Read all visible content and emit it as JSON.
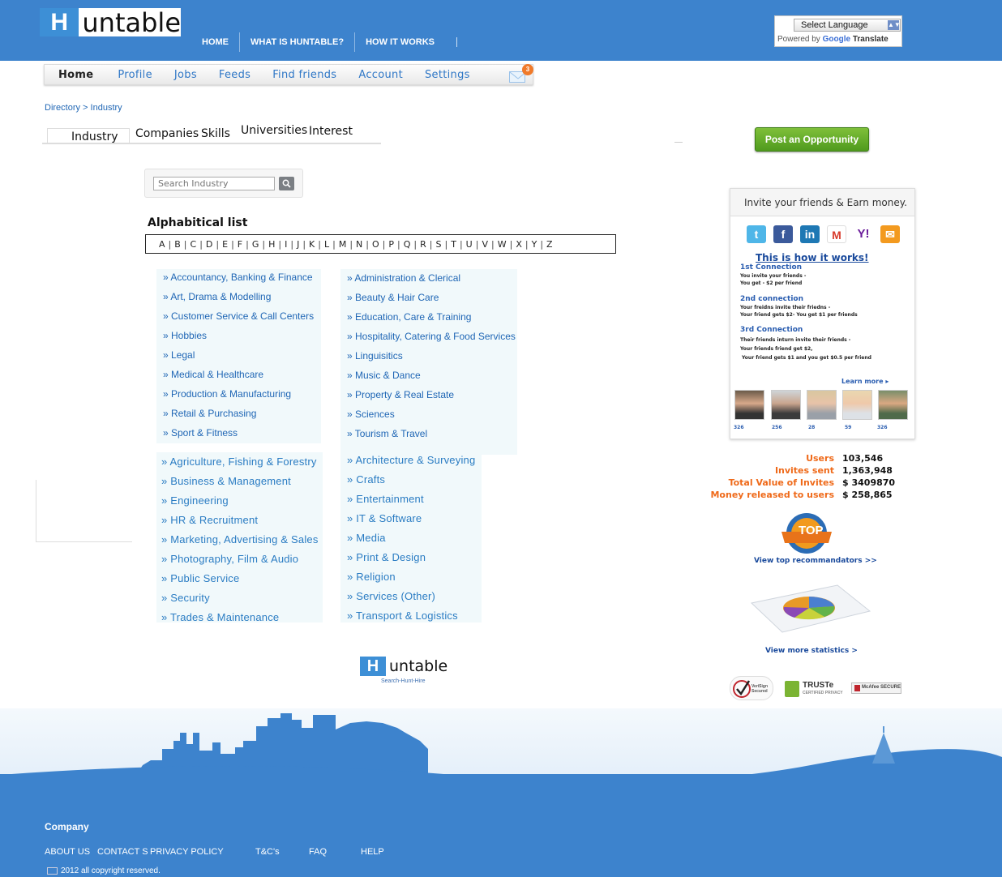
{
  "header": {
    "logo_letter": "H",
    "logo_rest": "untable",
    "nav": [
      "HOME",
      "WHAT IS HUNTABLE?",
      "HOW IT WORKS"
    ],
    "language_select": "Select Language",
    "powered_by": "Powered by",
    "google": "Google",
    "translate": "Translate"
  },
  "subnav": [
    "Home",
    "Profile",
    "Jobs",
    "Feeds",
    "Find friends",
    "Account",
    "Settings"
  ],
  "mail_count": "3",
  "breadcrumb": "Directory > Industry",
  "tabs": [
    "Industry",
    "Companies",
    "Skills",
    "Universities",
    "Interest"
  ],
  "post_button": "Post an Opportunity",
  "search": {
    "placeholder": "Search Industry"
  },
  "alpha_title": "Alphabitical list",
  "alphabet": [
    "A",
    "B",
    "C",
    "D",
    "E",
    "F",
    "G",
    "H",
    "I",
    "J",
    "K",
    "L",
    "M",
    "N",
    "O",
    "P",
    "Q",
    "R",
    "S",
    "T",
    "U",
    "V",
    "W",
    "X",
    "Y",
    "Z"
  ],
  "industries_a": {
    "left": [
      "» Accountancy, Banking & Finance",
      "» Art, Drama & Modelling",
      "» Customer Service & Call Centers",
      "» Hobbies",
      "» Legal",
      "» Medical & Healthcare",
      "» Production & Manufacturing",
      "» Retail & Purchasing",
      "» Sport & Fitness"
    ],
    "right": [
      "» Administration & Clerical",
      "» Beauty & Hair Care",
      "» Education, Care & Training",
      "» Hospitality, Catering & Food Services",
      "» Linguisitics",
      "» Music & Dance",
      "» Property & Real Estate",
      "» Sciences",
      "» Tourism & Travel"
    ]
  },
  "industries_b": {
    "left": [
      "» Agriculture, Fishing & Forestry",
      "» Business & Management",
      "» Engineering",
      "» HR & Recruitment",
      "» Marketing, Advertising & Sales",
      "» Photography, Film & Audio",
      "» Public Service",
      "» Security",
      "» Trades & Maintenance"
    ],
    "right": [
      "» Architecture & Surveying",
      "» Crafts",
      "» Entertainment",
      "» IT & Software",
      "» Media",
      "» Print & Design",
      "» Religion",
      "» Services (Other)",
      "» Transport & Logistics"
    ]
  },
  "footer_logo": {
    "letter": "H",
    "rest": "untable",
    "tagline": "Search-Hunt-Hire"
  },
  "invite": {
    "title": "Invite your friends & Earn money.",
    "how": "This is how it works!",
    "connections": [
      {
        "name": "1st Connection",
        "l1": "You invite your friends -",
        "l2": "You get - $2 per friend",
        "l3": ""
      },
      {
        "name": "2nd connection",
        "l1": "Your freidns invite their friedns -",
        "l2": "Your friend gets $2- You get $1 per friends",
        "l3": ""
      },
      {
        "name": "3rd Connection",
        "l1": "Their friends inturn invite their friends -",
        "l2": "Your friends friend get $2,",
        "l3": "Your friend gets $1 and you get $0.5 per friend"
      }
    ],
    "learn_more": "Learn more ▸",
    "photo_counts": [
      "326",
      "256",
      "28",
      "59",
      "326"
    ]
  },
  "stats": [
    {
      "label": "Users",
      "value": "103,546"
    },
    {
      "label": "Invites sent",
      "value": "1,363,948"
    },
    {
      "label": "Total Value of Invites",
      "value": "$ 3409870"
    },
    {
      "label": "Money released to users",
      "value": "$ 258,865"
    }
  ],
  "badge_text": "TOP",
  "top_link": "View top recommandators >>",
  "stats_link": "View more statistics >",
  "seals": [
    "VeriSign Secured",
    "TRUSTe",
    "CERTIFIED PRIVACY",
    "McAfee SECURE"
  ],
  "footer": {
    "company": "Company",
    "links": [
      "ABOUT US",
      "CONTACT S",
      "PRIVACY POLICY",
      "T&C's",
      "FAQ",
      "HELP"
    ],
    "copyright": "2012 all copyright reserved."
  },
  "colors": {
    "brand_blue": "#3d83cd",
    "link_blue": "#1f66b5",
    "accent_orange": "#ef6a1a",
    "post_green": "#6bb02e"
  }
}
